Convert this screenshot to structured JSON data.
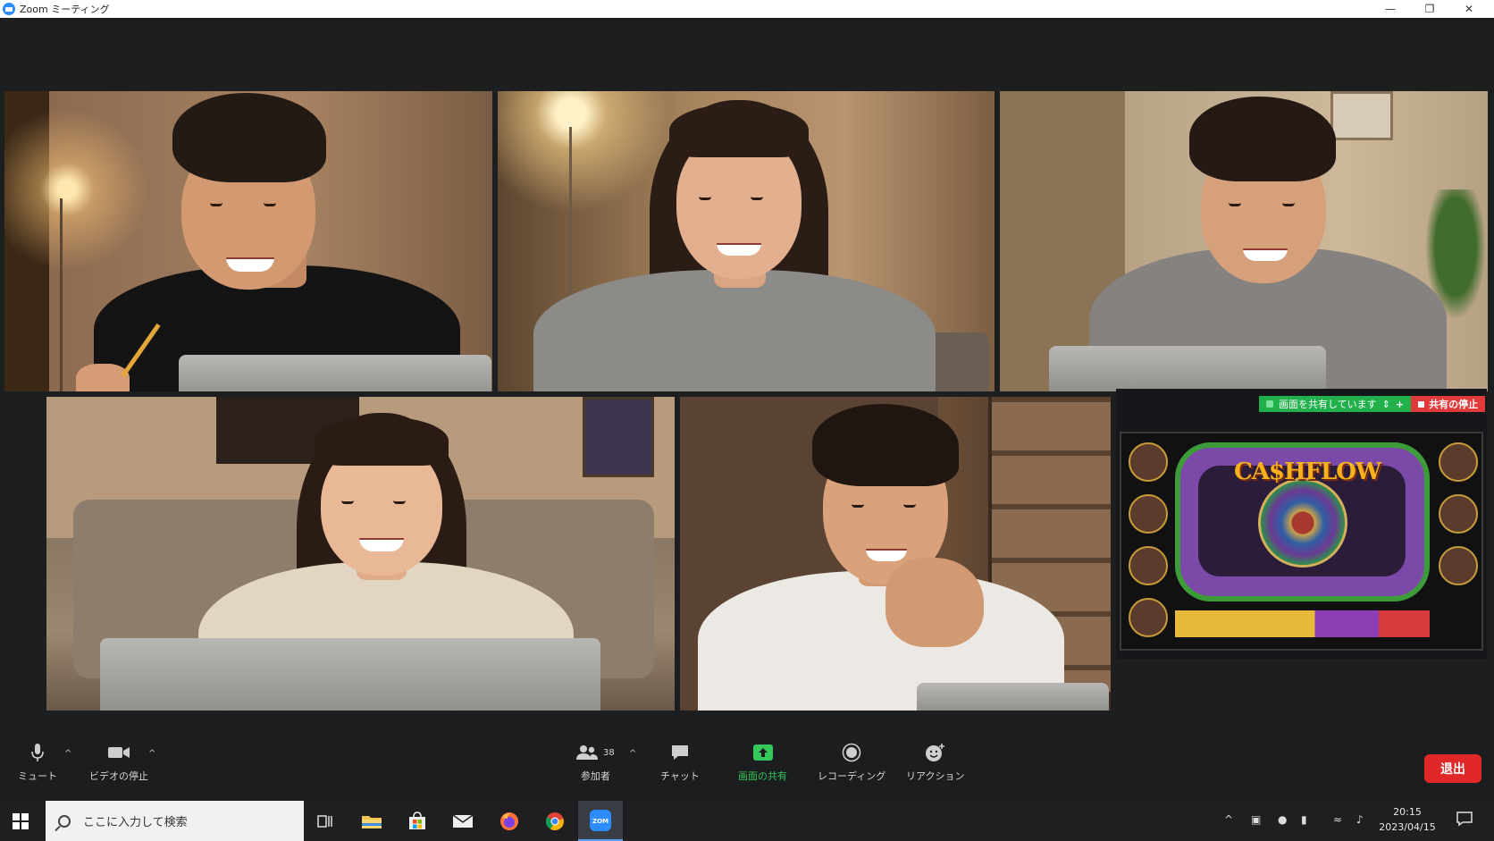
{
  "window": {
    "title": "Zoom ミーティング",
    "controls": [
      "minimize-icon",
      "restore-icon",
      "close-icon"
    ]
  },
  "share_banner": {
    "status": "画面を共有しています",
    "stop": "共有の停止"
  },
  "shared_content": {
    "logo_text": "CA$HFLOW"
  },
  "toolbar": {
    "mute": "ミュート",
    "video": "ビデオの停止",
    "participants_count": "38",
    "participants": "参加者",
    "chat": "チャット",
    "share": "画面の共有",
    "record": "レコーディング",
    "reactions": "リアクション",
    "leave": "退出"
  },
  "taskbar": {
    "search_placeholder": "ここに入力して検索",
    "time": "20:15",
    "date": "2023/04/15"
  },
  "colors": {
    "share_green": "#21b04b",
    "stop_red": "#e23a3a",
    "leave_red": "#e02828",
    "zoom_blue": "#2d8cff"
  }
}
